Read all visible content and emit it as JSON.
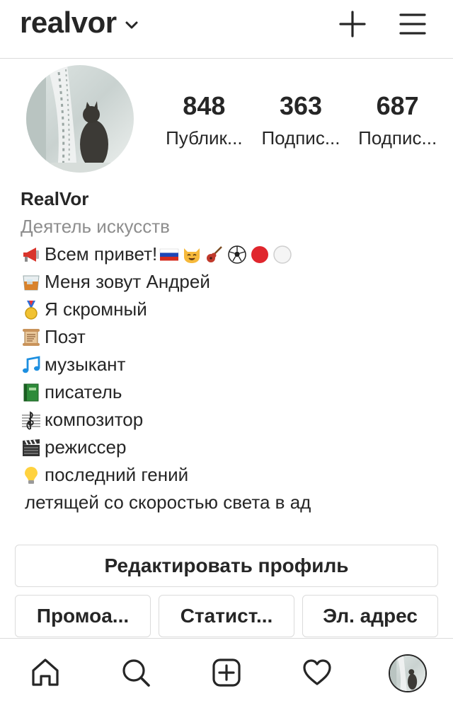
{
  "header": {
    "username": "realvor",
    "icons": {
      "dropdown": "chevron-down-icon",
      "new_post": "plus-icon",
      "menu": "hamburger-menu-icon"
    }
  },
  "profile": {
    "stats": [
      {
        "value": "848",
        "label": "Публик..."
      },
      {
        "value": "363",
        "label": "Подпис..."
      },
      {
        "value": "687",
        "label": "Подпис..."
      }
    ]
  },
  "bio": {
    "name": "RealVor",
    "category": "Деятель искусств",
    "lines": [
      "Всем привет!",
      "Меня зовут Андрей",
      "Я скромный",
      "Поэт",
      "музыкант",
      "писатель",
      "композитор",
      "режиссер",
      "последний гений",
      "летящей со скоростью света в ад"
    ],
    "line_icons": [
      "megaphone-icon",
      "whisky-glass-icon",
      "medal-icon",
      "scroll-icon",
      "music-notes-icon",
      "green-book-icon",
      "musical-score-icon",
      "clapper-board-icon",
      "light-bulb-icon"
    ],
    "first_line_trailing_icons": [
      "russia-flag-icon",
      "cat-face-icon",
      "guitar-icon",
      "soccer-ball-icon",
      "red-circle-icon",
      "white-circle-icon"
    ]
  },
  "actions": {
    "edit_profile": "Редактировать профиль",
    "promo": "Промоа...",
    "stats": "Статист...",
    "email": "Эл. адрес"
  },
  "bottom_nav": {
    "icons": [
      "home-icon",
      "search-icon",
      "new-post-icon",
      "heart-icon",
      "profile-avatar"
    ]
  }
}
